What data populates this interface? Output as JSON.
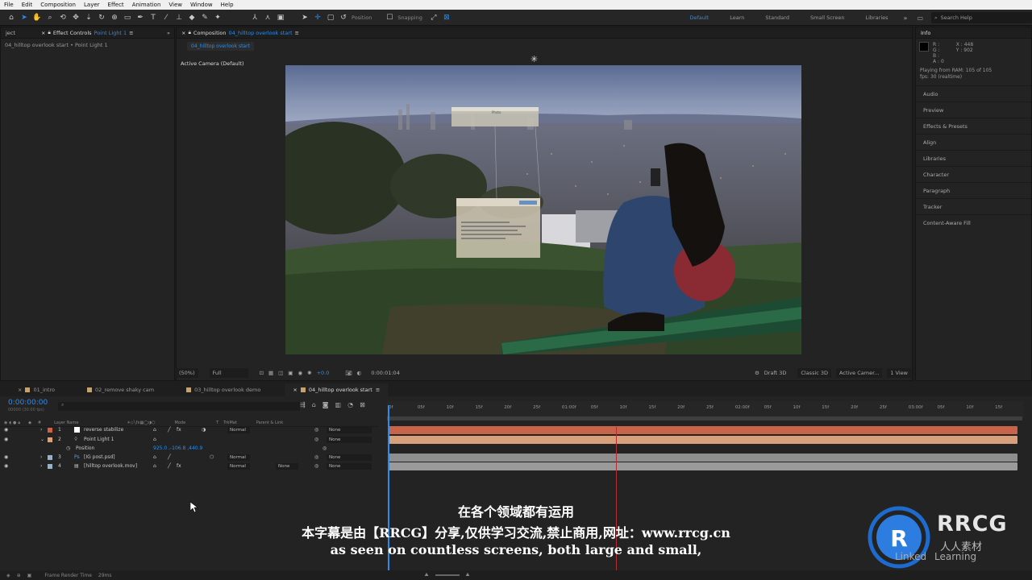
{
  "menu": [
    "File",
    "Edit",
    "Composition",
    "Layer",
    "Effect",
    "Animation",
    "View",
    "Window",
    "Help"
  ],
  "toolbar": {
    "position_label": "Position",
    "snapping_label": "Snapping"
  },
  "workspaces": [
    "Default",
    "Learn",
    "Standard",
    "Small Screen",
    "Libraries"
  ],
  "active_workspace": "Default",
  "search_placeholder": "Search Help",
  "effect_panel": {
    "left_tab": "ject",
    "tab_label": "Effect Controls",
    "tab_target": "Point Light 1",
    "subtitle": "04_hilltop overlook start • Point Light 1"
  },
  "comp_panel": {
    "tab_label": "Composition",
    "tab_target": "04_hilltop overlook start",
    "sub_tab": "04_hilltop overlook start",
    "camera_label": "Active Camera (Default)"
  },
  "viewer_bar": {
    "zoom": "(50%)",
    "resolution": "Full",
    "exposure": "+0.0",
    "timecode": "0:00:01:04",
    "renderer_label": "Draft 3D",
    "renderer": "Classic 3D",
    "camera": "Active Camer...",
    "views": "1 View"
  },
  "overlay_cards": {
    "card_title": "Photo"
  },
  "info_panel": {
    "title": "Info",
    "rgb": [
      "R :",
      "G :",
      "B :",
      "A : 0"
    ],
    "coords": [
      "X : 448",
      "Y : 902"
    ],
    "playing": "Playing from RAM: 105 of 105",
    "fps": "fps: 30 (realtime)",
    "items": [
      "Audio",
      "Preview",
      "Effects & Presets",
      "Align",
      "Libraries",
      "Character",
      "Paragraph",
      "Tracker",
      "Content-Aware Fill"
    ]
  },
  "timeline": {
    "tabs": [
      "01_intro",
      "02_remove shaky cam",
      "03_hilltop overlook demo",
      "04_hilltop overlook start"
    ],
    "timecode": "0:00:00:00",
    "timecode_sub": "00000 (30.00 fps)",
    "columns": {
      "layer_name": "Layer Name",
      "mode": "Mode",
      "t": "T",
      "trkmat": "TrkMat",
      "parent": "Parent & Link"
    },
    "layers": [
      {
        "num": "1",
        "name": "reverse stabilize",
        "mode": "Normal",
        "trkmat": "",
        "parent": "None",
        "color": "#d06040"
      },
      {
        "num": "2",
        "name": "Point Light 1",
        "mode": "",
        "trkmat": "",
        "parent": "None",
        "color": "#e0a070"
      },
      {
        "num": "3",
        "name": "[IG post.psd]",
        "mode": "Normal",
        "trkmat": "",
        "parent": "None",
        "color": "#9ab0c8"
      },
      {
        "num": "4",
        "name": "[hilltop overlook.mov]",
        "mode": "Normal",
        "trkmat": "None",
        "parent": "None",
        "color": "#9ab0c8"
      }
    ],
    "position_prop": {
      "label": "Position",
      "value": "925.0 ,-106.8 ,440.9"
    },
    "ruler": [
      "0f",
      "05f",
      "10f",
      "15f",
      "20f",
      "25f",
      "01:00f",
      "05f",
      "10f",
      "15f",
      "20f",
      "25f",
      "02:00f",
      "05f",
      "10f",
      "15f",
      "20f",
      "25f",
      "03:00f",
      "05f",
      "10f",
      "15f"
    ],
    "bars": [
      "#c86449",
      "#d8a07a",
      "#8e8e8e",
      "#9a9a9a"
    ]
  },
  "status": {
    "label": "Frame Render Time",
    "value": "29ms"
  },
  "subtitles": {
    "line1": "在各个领域都有运用",
    "line2": "本字幕是由【RRCG】分享,仅供学习交流,禁止商用,网址：www.rrcg.cn",
    "line3": "as seen on countless screens, both large and small,"
  },
  "watermark": {
    "brand": "RRCG",
    "sub": "人人素材",
    "linkedin": "Linked",
    "learning": "Learning"
  }
}
